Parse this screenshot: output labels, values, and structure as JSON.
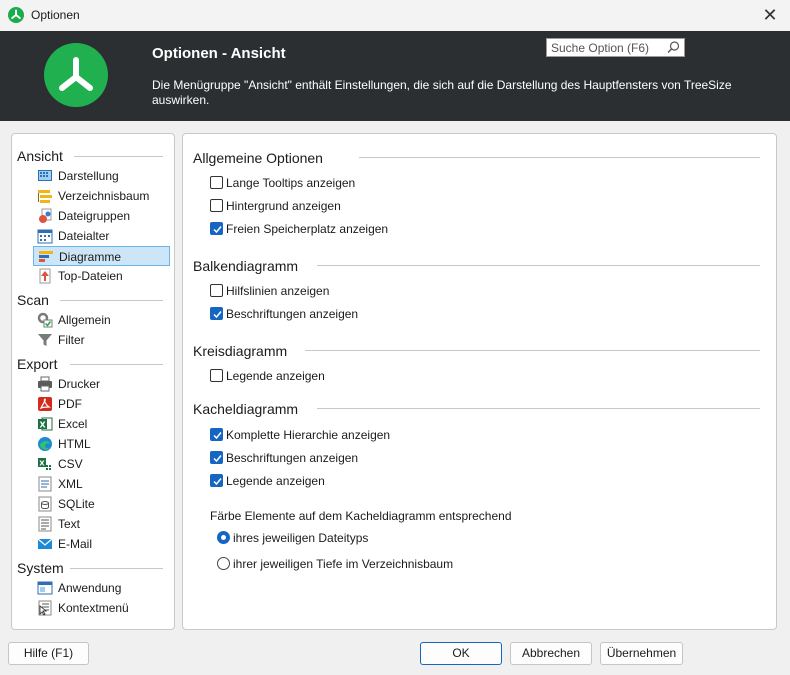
{
  "window": {
    "title": "Optionen"
  },
  "header": {
    "heading": "Optionen - Ansicht",
    "description": "Die Menügruppe \"Ansicht\" enthält Einstellungen, die sich auf die Darstellung des Hauptfensters von TreeSize auswirken.",
    "search_placeholder": "Suche Option (F6)"
  },
  "nav": {
    "sections": [
      {
        "label": "Ansicht",
        "items": [
          {
            "label": "Darstellung",
            "icon": "display-icon"
          },
          {
            "label": "Verzeichnisbaum",
            "icon": "tree-icon"
          },
          {
            "label": "Dateigruppen",
            "icon": "filegroups-icon"
          },
          {
            "label": "Dateialter",
            "icon": "calendar-icon"
          },
          {
            "label": "Diagramme",
            "icon": "chart-icon",
            "selected": true
          },
          {
            "label": "Top-Dateien",
            "icon": "top-files-icon"
          }
        ]
      },
      {
        "label": "Scan",
        "items": [
          {
            "label": "Allgemein",
            "icon": "gear-icon"
          },
          {
            "label": "Filter",
            "icon": "filter-icon"
          }
        ]
      },
      {
        "label": "Export",
        "items": [
          {
            "label": "Drucker",
            "icon": "printer-icon"
          },
          {
            "label": "PDF",
            "icon": "pdf-icon"
          },
          {
            "label": "Excel",
            "icon": "excel-icon"
          },
          {
            "label": "HTML",
            "icon": "html-icon"
          },
          {
            "label": "CSV",
            "icon": "csv-icon"
          },
          {
            "label": "XML",
            "icon": "xml-icon"
          },
          {
            "label": "SQLite",
            "icon": "sqlite-icon"
          },
          {
            "label": "Text",
            "icon": "text-icon"
          },
          {
            "label": "E-Mail",
            "icon": "email-icon"
          }
        ]
      },
      {
        "label": "System",
        "items": [
          {
            "label": "Anwendung",
            "icon": "application-icon"
          },
          {
            "label": "Kontextmenü",
            "icon": "context-menu-icon"
          }
        ]
      }
    ]
  },
  "content": {
    "groups": [
      {
        "title": "Allgemeine Optionen",
        "options": [
          {
            "label": "Lange Tooltips anzeigen",
            "checked": false
          },
          {
            "label": "Hintergrund anzeigen",
            "checked": false
          },
          {
            "label": "Freien Speicherplatz anzeigen",
            "checked": true
          }
        ]
      },
      {
        "title": "Balkendiagramm",
        "options": [
          {
            "label": "Hilfslinien anzeigen",
            "checked": false
          },
          {
            "label": "Beschriftungen anzeigen",
            "checked": true
          }
        ]
      },
      {
        "title": "Kreisdiagramm",
        "options": [
          {
            "label": "Legende anzeigen",
            "checked": false
          }
        ]
      },
      {
        "title": "Kacheldiagramm",
        "options": [
          {
            "label": "Komplette Hierarchie anzeigen",
            "checked": true
          },
          {
            "label": "Beschriftungen anzeigen",
            "checked": true
          },
          {
            "label": "Legende anzeigen",
            "checked": true
          }
        ]
      }
    ],
    "color_note": "Färbe Elemente auf dem Kacheldiagramm entsprechend",
    "color_options": [
      {
        "label": "ihres jeweiligen Dateityps",
        "selected": true
      },
      {
        "label": "ihrer jeweiligen Tiefe im Verzeichnisbaum",
        "selected": false
      }
    ]
  },
  "footer": {
    "help": "Hilfe (F1)",
    "ok": "OK",
    "cancel": "Abbrechen",
    "apply": "Übernehmen"
  },
  "colors": {
    "brand": "#21b04f",
    "header_bg": "#2b2f31",
    "accent": "#1466c2",
    "selection": "#cde6f7"
  }
}
